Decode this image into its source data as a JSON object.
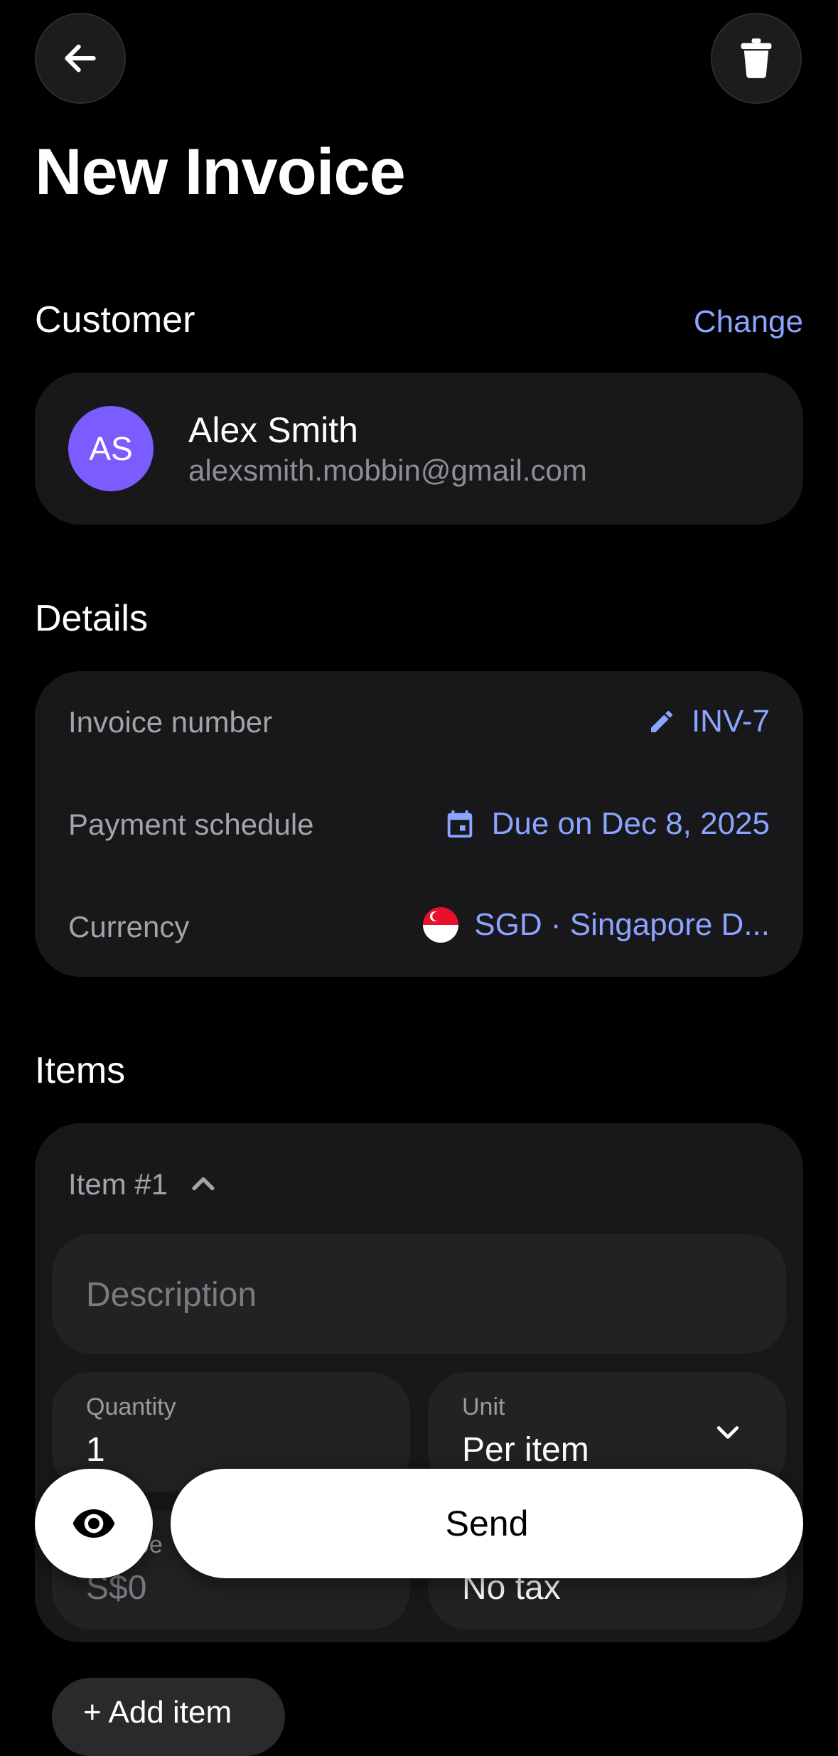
{
  "header": {
    "title": "New Invoice"
  },
  "customer": {
    "section_title": "Customer",
    "change_label": "Change",
    "avatar_initials": "AS",
    "avatar_color": "#7b5cff",
    "name": "Alex Smith",
    "email": "alexsmith.mobbin@gmail.com"
  },
  "details": {
    "section_title": "Details",
    "rows": [
      {
        "label": "Invoice number",
        "value": "INV-7",
        "icon": "pencil-icon"
      },
      {
        "label": "Payment schedule",
        "value": "Due on Dec 8, 2025",
        "icon": "calendar-icon"
      },
      {
        "label": "Currency",
        "value": "SGD · Singapore D...",
        "icon": "singapore-flag-icon"
      }
    ]
  },
  "items": {
    "section_title": "Items",
    "item_title": "Item #1",
    "description_placeholder": "Description",
    "quantity_label": "Quantity",
    "quantity_value": "1",
    "unit_label": "Unit",
    "unit_value": "Per item",
    "price_label": "Unit pe",
    "price_value": "S$0",
    "tax_value": "No tax",
    "add_item_label": "+ Add item"
  },
  "actions": {
    "send_label": "Send",
    "preview_icon": "eye-icon"
  },
  "colors": {
    "accent": "#8aa4ff",
    "background": "#000000",
    "card": "#18181a"
  }
}
